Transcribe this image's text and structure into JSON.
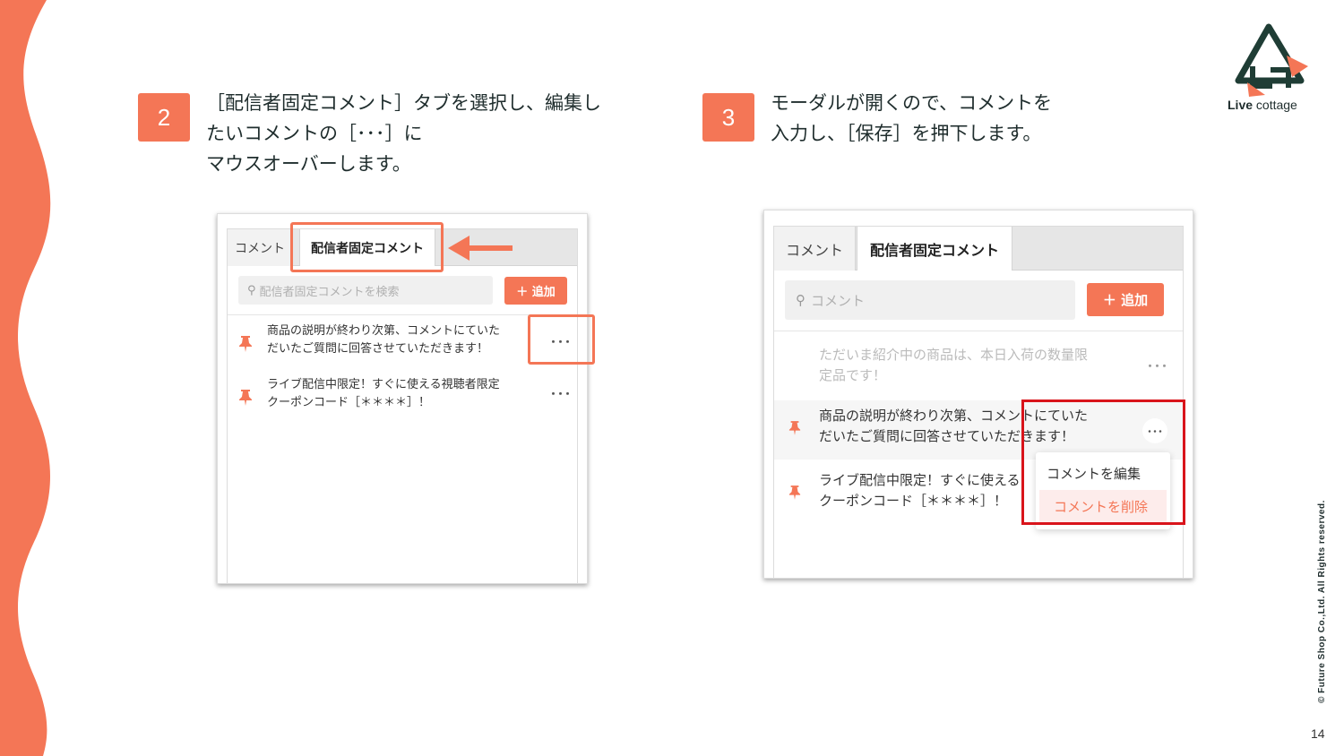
{
  "steps": [
    {
      "number": "2",
      "lines": [
        "［配信者固定コメント］タブを選択し、編集し",
        "たいコメントの［･･･］に",
        "マウスオーバーします。"
      ]
    },
    {
      "number": "3",
      "lines": [
        "モーダルが開くので、コメントを",
        "入力し、［保存］を押下します。"
      ]
    }
  ],
  "logo": {
    "brand_bold": "Live",
    "brand_rest": " cottage"
  },
  "copyright": "© Future Shop Co.,Ltd. All Rights reserved.",
  "page_number": "14",
  "panel1": {
    "tab_comment": "コメント",
    "tab_pinned": "配信者固定コメント",
    "search_placeholder": "配信者固定コメントを検索",
    "add_label": "＋ 追加",
    "items": [
      {
        "line1": "商品の説明が終わり次第、コメントにていた",
        "line2": "だいたご質問に回答させていただきます！",
        "menu": "･･･"
      },
      {
        "line1": "ライブ配信中限定！すぐに使える視聴者限定",
        "line2": "クーポンコード［＊＊＊＊］！",
        "menu": "･･･"
      }
    ]
  },
  "panel2": {
    "tab_comment": "コメント",
    "tab_pinned": "配信者固定コメント",
    "search_placeholder": "コメント",
    "add_label": "＋ 追加",
    "items": [
      {
        "line1": "ただいま紹介中の商品は、本日入荷の数量限",
        "line2": "定品です！",
        "menu": "･･･"
      },
      {
        "line1": "商品の説明が終わり次第、コメントにていた",
        "line2": "だいたご質問に回答させていただきます！",
        "menu": "･･･"
      },
      {
        "line1": "ライブ配信中限定！すぐに使える",
        "line2": "クーポンコード［＊＊＊＊］！"
      }
    ],
    "menu_edit": "コメントを編集",
    "menu_delete": "コメントを削除"
  },
  "colors": {
    "accent": "#f47656",
    "highlight_red": "#d9141b",
    "logo_green": "#1f3d35"
  }
}
